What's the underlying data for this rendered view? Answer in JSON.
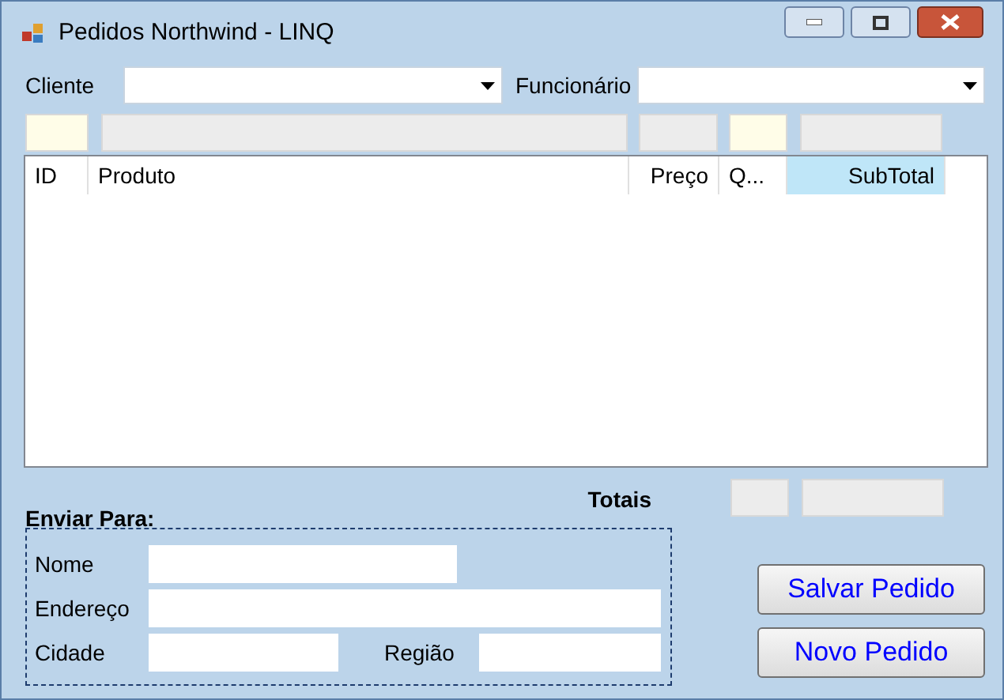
{
  "window": {
    "title": "Pedidos Northwind - LINQ"
  },
  "filters": [
    {
      "label": "Cliente"
    },
    {
      "label": "Funcionário"
    }
  ],
  "entry_boxes": [
    {
      "kind": "tinted"
    },
    {
      "kind": "plain"
    },
    {
      "kind": "plain"
    },
    {
      "kind": "tinted"
    },
    {
      "kind": "plain"
    }
  ],
  "grid": {
    "columns": [
      {
        "label": "ID",
        "selected": false
      },
      {
        "label": "Produto",
        "selected": false
      },
      {
        "label": "Preço",
        "selected": false
      },
      {
        "label": "Q...",
        "selected": false
      },
      {
        "label": "SubTotal",
        "selected": true
      }
    ]
  },
  "totals": {
    "label": "Totais"
  },
  "ship_to": {
    "title": "Enviar Para:",
    "fields": [
      {
        "label": "Nome"
      },
      {
        "label": "Endereço"
      },
      {
        "label": "Cidade"
      },
      {
        "label": "Região"
      }
    ]
  },
  "buttons": [
    "Salvar Pedido",
    "Novo Pedido"
  ]
}
